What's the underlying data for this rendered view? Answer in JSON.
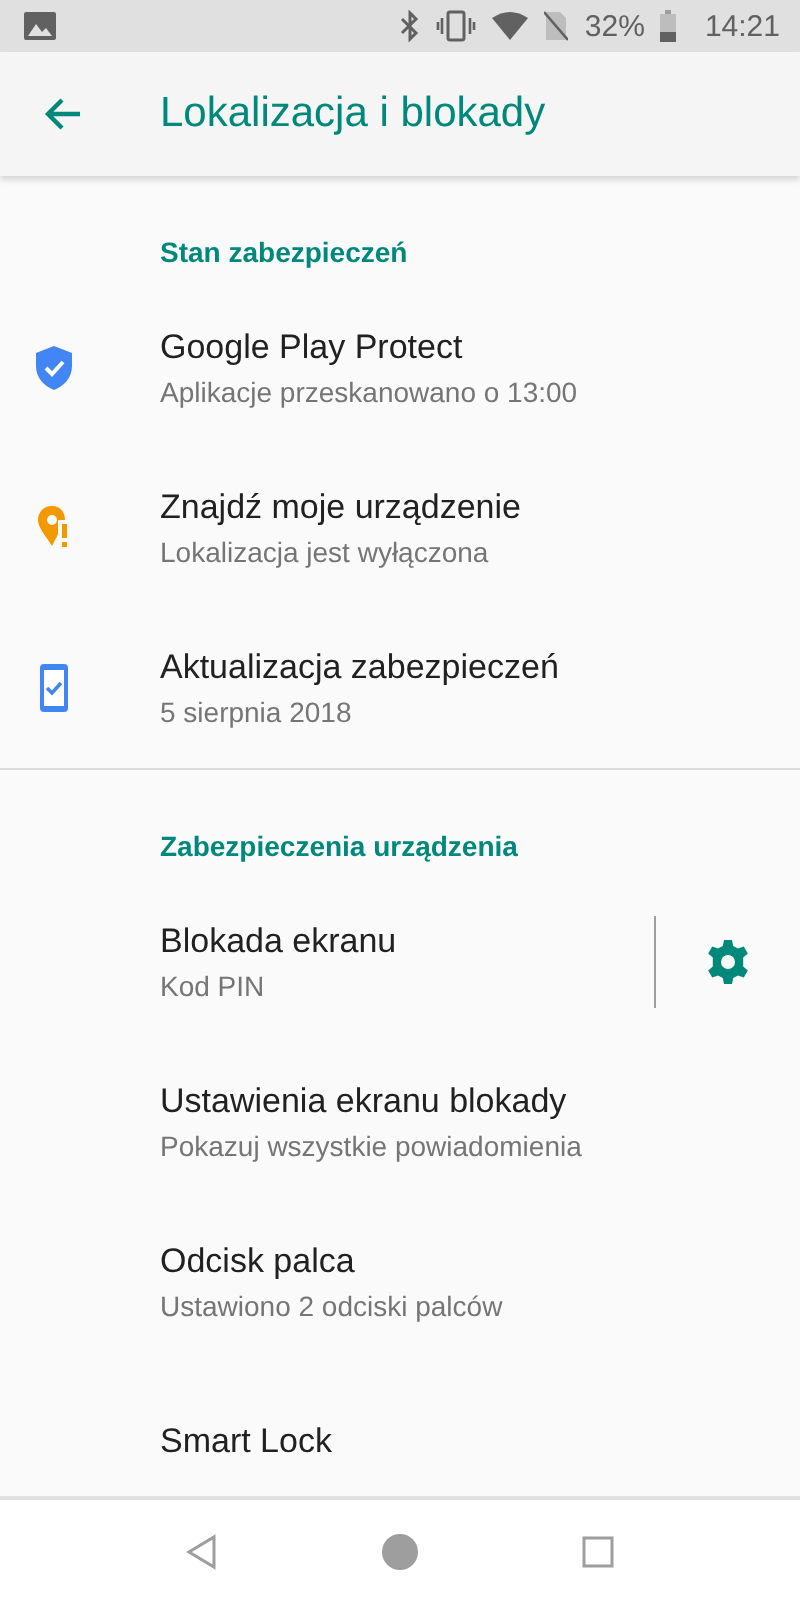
{
  "status_bar": {
    "battery": "32%",
    "time": "14:21"
  },
  "app_bar": {
    "title": "Lokalizacja i blokady"
  },
  "sections": [
    {
      "header": "Stan zabezpieczeń",
      "items": [
        {
          "title": "Google Play Protect",
          "summary": "Aplikacje przeskanowano o 13:00",
          "settings_button": false
        },
        {
          "title": "Znajdź moje urządzenie",
          "summary": "Lokalizacja jest wyłączona",
          "settings_button": false
        },
        {
          "title": "Aktualizacja zabezpieczeń",
          "summary": "5 sierpnia 2018",
          "settings_button": false
        }
      ]
    },
    {
      "header": "Zabezpieczenia urządzenia",
      "items": [
        {
          "title": "Blokada ekranu",
          "summary": "Kod PIN",
          "settings_button": true
        },
        {
          "title": "Ustawienia ekranu blokady",
          "summary": "Pokazuj wszystkie powiadomienia",
          "settings_button": false
        },
        {
          "title": "Odcisk palca",
          "summary": "Ustawiono 2 odciski palców",
          "settings_button": false
        },
        {
          "title": "Smart Lock",
          "settings_button": false
        }
      ]
    }
  ]
}
